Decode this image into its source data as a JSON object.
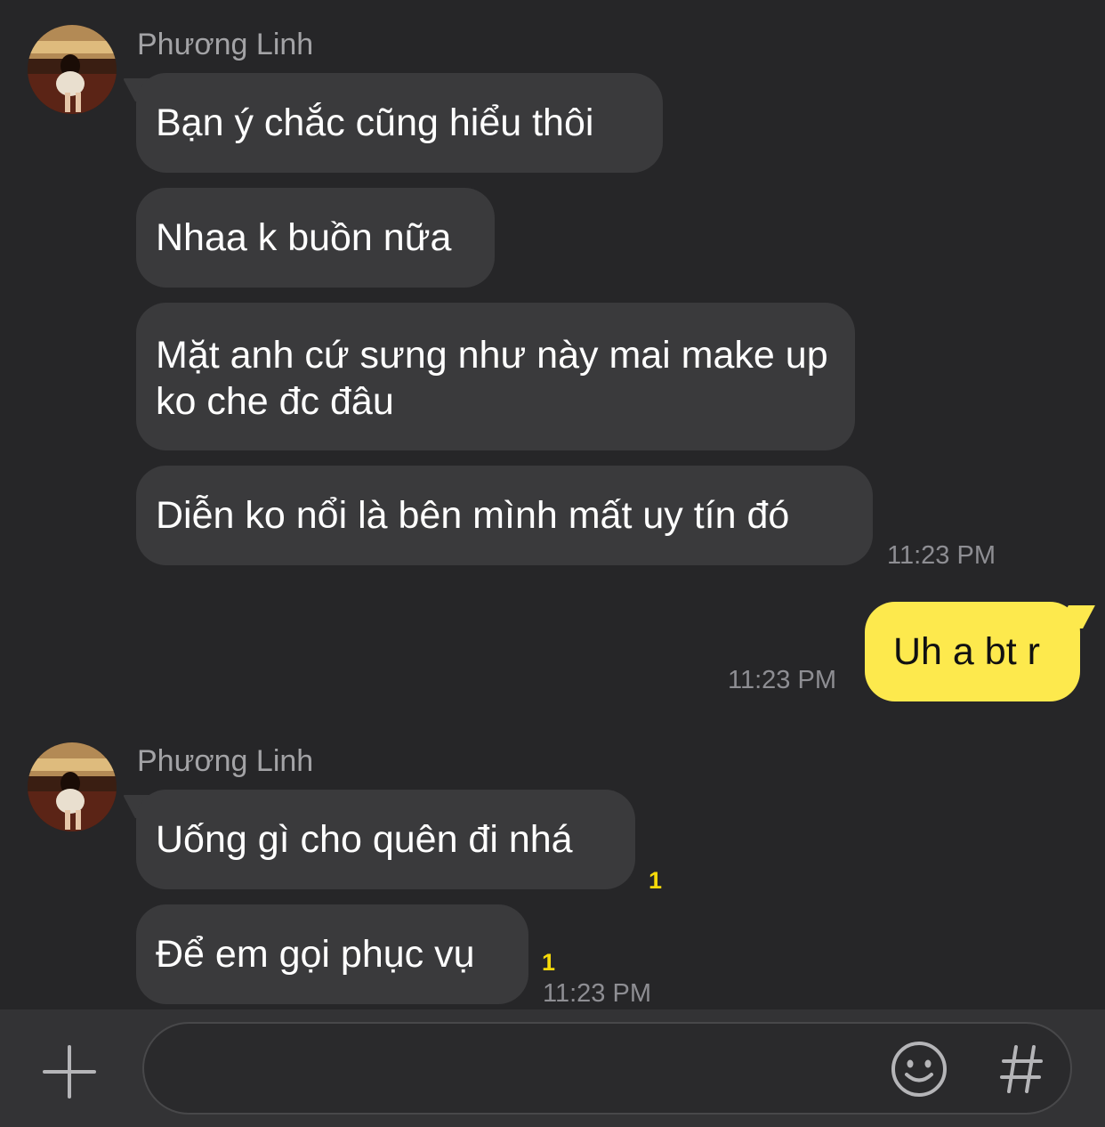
{
  "conversation": {
    "groups": [
      {
        "sender": "Phương Linh",
        "messages": [
          "Bạn ý chắc cũng hiểu thôi",
          "Nhaa k buồn nữa",
          "Mặt anh cứ sưng như này mai make up ko che đc đâu",
          "Diễn ko nổi là bên mình mất uy tín đó"
        ],
        "time": "11:23 PM"
      },
      {
        "sender": "me",
        "messages": [
          "Uh a bt r"
        ],
        "time": "11:23 PM"
      },
      {
        "sender": "Phương Linh",
        "messages": [
          "Uống gì cho quên đi nhá",
          "Để em gọi phục vụ"
        ],
        "unread_counts": [
          "1",
          "1"
        ],
        "time": "11:23 PM"
      }
    ]
  },
  "composer": {
    "placeholder": "",
    "icons": [
      "plus-icon",
      "emoji-icon",
      "hashtag-icon"
    ]
  },
  "colors": {
    "background": "#262628",
    "incoming_bubble": "#3a3a3c",
    "outgoing_bubble": "#fde94d",
    "unread_badge": "#f5d90a",
    "timestamp": "#8e8e93",
    "sender_name": "#a3a3a6"
  }
}
